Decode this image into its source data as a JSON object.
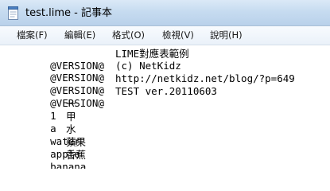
{
  "window": {
    "title": "test.lime - 記事本",
    "app_icon": "notepad-icon"
  },
  "menu": {
    "items": [
      {
        "label": "檔案(F)"
      },
      {
        "label": "編輯(E)"
      },
      {
        "label": "格式(O)"
      },
      {
        "label": "檢視(V)"
      },
      {
        "label": "說明(H)"
      }
    ]
  },
  "editor": {
    "lines": [
      {
        "key": "@VERSION@",
        "value": "LIME對應表範例"
      },
      {
        "key": "@VERSION@",
        "value": "(c) NetKidz"
      },
      {
        "key": "@VERSION@",
        "value": "http://netkidz.net/blog/?p=649"
      },
      {
        "key": "@VERSION@",
        "value": "TEST ver.20110603"
      },
      {
        "key": "1",
        "value": "一"
      },
      {
        "key": "a",
        "value": "甲"
      },
      {
        "key": "water",
        "value": "水"
      },
      {
        "key": "apple",
        "value": "蘋果"
      },
      {
        "key": "banana",
        "value": "香蕉"
      }
    ]
  }
}
